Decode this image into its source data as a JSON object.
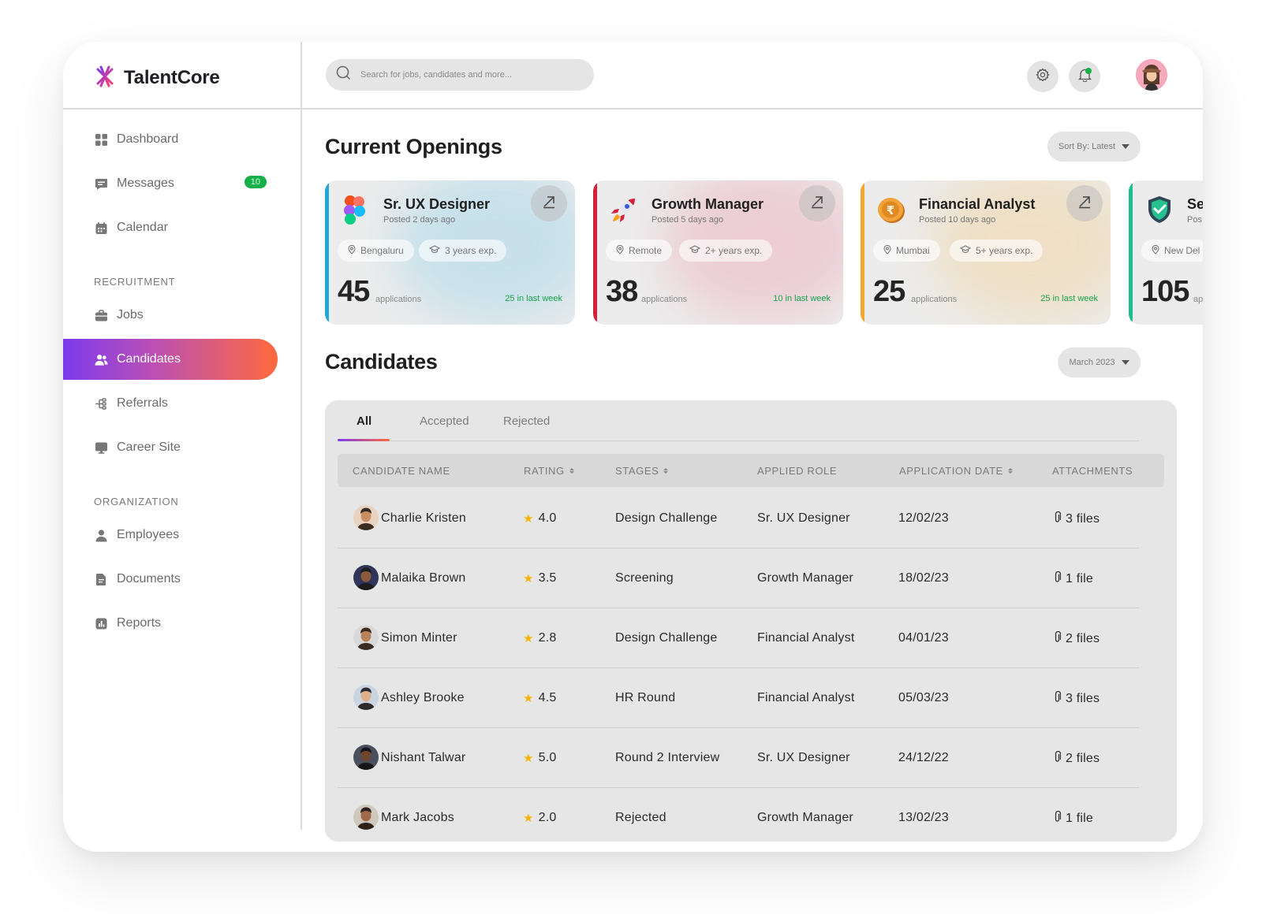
{
  "app": {
    "name": "TalentCore",
    "brand_colors": [
      "#7c3aed",
      "#ff6a3d"
    ]
  },
  "search": {
    "placeholder": "Search for jobs, candidates and more..."
  },
  "sidebar": {
    "items": [
      {
        "label": "Dashboard",
        "icon": "grid-icon"
      },
      {
        "label": "Messages",
        "icon": "chat-icon",
        "badge": "10"
      },
      {
        "label": "Calendar",
        "icon": "calendar-icon"
      }
    ],
    "recruitment_label": "RECRUITMENT",
    "recruitment": [
      {
        "label": "Jobs",
        "icon": "briefcase-icon"
      },
      {
        "label": "Candidates",
        "icon": "users-icon",
        "active": true
      },
      {
        "label": "Referrals",
        "icon": "share-tree-icon"
      },
      {
        "label": "Career Site",
        "icon": "monitor-icon"
      }
    ],
    "organization_label": "ORGANIZATION",
    "organization": [
      {
        "label": "Employees",
        "icon": "person-icon"
      },
      {
        "label": "Documents",
        "icon": "document-icon"
      },
      {
        "label": "Reports",
        "icon": "report-icon"
      }
    ]
  },
  "openings": {
    "title": "Current Openings",
    "sort_label": "Sort By: Latest",
    "cards": [
      {
        "title": "Sr. UX Designer",
        "posted": "Posted 2 days ago",
        "location": "Bengaluru",
        "experience": "3 years exp.",
        "count": "45",
        "count_label": "applications",
        "last_week": "25 in last week",
        "accent": "#22a7d6",
        "icon": "figma-icon"
      },
      {
        "title": "Growth Manager",
        "posted": "Posted 5 days ago",
        "location": "Remote",
        "experience": "2+ years exp.",
        "count": "38",
        "count_label": "applications",
        "last_week": "10 in last week",
        "accent": "#d61f3a",
        "icon": "rocket-icon"
      },
      {
        "title": "Financial Analyst",
        "posted": "Posted 10 days ago",
        "location": "Mumbai",
        "experience": "5+ years exp.",
        "count": "25",
        "count_label": "applications",
        "last_week": "25 in last week",
        "accent": "#f0a830",
        "icon": "rupee-coin-icon"
      },
      {
        "title": "Se",
        "posted": "Pos",
        "location": "New Del",
        "count": "105",
        "count_label": "ap",
        "accent": "#1fbf8f",
        "icon": "shield-icon"
      }
    ]
  },
  "candidates": {
    "title": "Candidates",
    "period": "March 2023",
    "tabs": [
      "All",
      "Accepted",
      "Rejected"
    ],
    "active_tab": "All",
    "columns": [
      "CANDIDATE NAME",
      "RATING",
      "STAGES",
      "APPLIED ROLE",
      "APPLICATION DATE",
      "ATTACHMENTS"
    ],
    "rows": [
      {
        "name": "Charlie Kristen",
        "rating": "4.0",
        "stage": "Design Challenge",
        "role": "Sr. UX Designer",
        "date": "12/02/23",
        "attachments": "3 files"
      },
      {
        "name": "Malaika Brown",
        "rating": "3.5",
        "stage": "Screening",
        "role": "Growth Manager",
        "date": "18/02/23",
        "attachments": "1 file"
      },
      {
        "name": "Simon Minter",
        "rating": "2.8",
        "stage": "Design Challenge",
        "role": "Financial Analyst",
        "date": "04/01/23",
        "attachments": "2 files"
      },
      {
        "name": "Ashley Brooke",
        "rating": "4.5",
        "stage": "HR Round",
        "role": "Financial Analyst",
        "date": "05/03/23",
        "attachments": "3 files"
      },
      {
        "name": "Nishant Talwar",
        "rating": "5.0",
        "stage": "Round 2 Interview",
        "role": "Sr. UX Designer",
        "date": "24/12/22",
        "attachments": "2 files"
      },
      {
        "name": "Mark Jacobs",
        "rating": "2.0",
        "stage": "Rejected",
        "role": "Growth Manager",
        "date": "13/02/23",
        "attachments": "1 file"
      }
    ]
  }
}
